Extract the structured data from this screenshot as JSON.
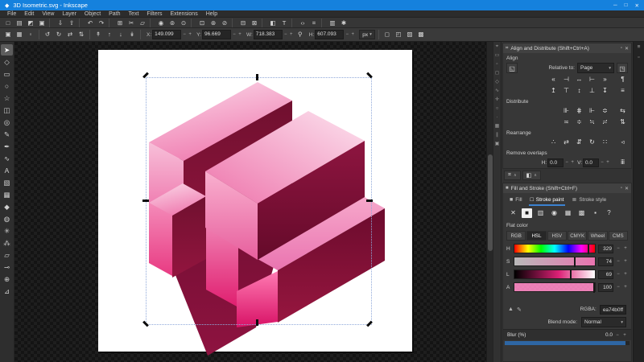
{
  "window": {
    "title": "3D Isometric.svg - Inkscape",
    "logo_glyph": "◆",
    "minimize_glyph": "─",
    "maximize_glyph": "□",
    "close_glyph": "✕"
  },
  "menu": {
    "items": [
      "File",
      "Edit",
      "View",
      "Layer",
      "Object",
      "Path",
      "Text",
      "Filters",
      "Extensions",
      "Help"
    ]
  },
  "command_toolbar": {
    "items": [
      {
        "name": "new-document-icon",
        "glyph": "□"
      },
      {
        "name": "open-icon",
        "glyph": "▤"
      },
      {
        "name": "save-icon",
        "glyph": "◩"
      },
      {
        "name": "print-icon",
        "glyph": "▣"
      },
      {
        "sep": "true",
        "inter": "false"
      },
      {
        "name": "import-icon",
        "glyph": "⇩"
      },
      {
        "name": "export-icon",
        "glyph": "⇧"
      },
      {
        "sep": "true",
        "inter": "false"
      },
      {
        "name": "undo-icon",
        "glyph": "↶"
      },
      {
        "name": "redo-icon",
        "glyph": "↷"
      },
      {
        "sep": "true",
        "inter": "false"
      },
      {
        "name": "copy-icon",
        "glyph": "⊞"
      },
      {
        "name": "cut-icon",
        "glyph": "✂"
      },
      {
        "name": "paste-icon",
        "glyph": "▱"
      },
      {
        "sep": "true",
        "inter": "false"
      },
      {
        "name": "zoom-selection-icon",
        "glyph": "◉"
      },
      {
        "name": "zoom-drawing-icon",
        "glyph": "⊚"
      },
      {
        "name": "zoom-page-icon",
        "glyph": "⊙"
      },
      {
        "sep": "true",
        "inter": "false"
      },
      {
        "name": "duplicate-icon",
        "glyph": "⊡"
      },
      {
        "name": "clone-icon",
        "glyph": "⊛"
      },
      {
        "name": "unlink-clone-icon",
        "glyph": "⊘"
      },
      {
        "sep": "true",
        "inter": "false"
      },
      {
        "name": "group-icon",
        "glyph": "⊟"
      },
      {
        "name": "ungroup-icon",
        "glyph": "⊠"
      },
      {
        "sep": "true",
        "inter": "false"
      },
      {
        "name": "fill-stroke-dialog-icon",
        "glyph": "◧"
      },
      {
        "name": "text-dialog-icon",
        "glyph": "T"
      },
      {
        "sep": "true",
        "inter": "false"
      },
      {
        "name": "xml-editor-icon",
        "glyph": "‹›"
      },
      {
        "name": "align-dialog-icon",
        "glyph": "⌗"
      },
      {
        "sep": "true",
        "inter": "false"
      },
      {
        "name": "document-properties-icon",
        "glyph": "▥"
      },
      {
        "name": "preferences-icon",
        "glyph": "✱"
      }
    ]
  },
  "tool_options": {
    "select_icons": [
      {
        "name": "select-all-icon",
        "glyph": "▣"
      },
      {
        "name": "select-all-layers-icon",
        "glyph": "▦"
      },
      {
        "name": "deselect-icon",
        "glyph": "▫"
      }
    ],
    "transform_icons": [
      {
        "name": "rotate-ccw-icon",
        "glyph": "↺"
      },
      {
        "name": "rotate-cw-icon",
        "glyph": "↻"
      },
      {
        "name": "flip-horizontal-icon",
        "glyph": "⇄"
      },
      {
        "name": "flip-vertical-icon",
        "glyph": "⇅"
      }
    ],
    "zorder_icons": [
      {
        "name": "raise-to-top-icon",
        "glyph": "↟"
      },
      {
        "name": "raise-icon",
        "glyph": "↑"
      },
      {
        "name": "lower-icon",
        "glyph": "↓"
      },
      {
        "name": "lower-to-bottom-icon",
        "glyph": "↡"
      }
    ],
    "x_label": "X:",
    "x_value": "149.099",
    "y_label": "Y:",
    "y_value": "96.669",
    "w_label": "W:",
    "w_value": "718.383",
    "h_label": "H:",
    "h_value": "607.093",
    "lock_glyph": "⚲",
    "units_value": "px",
    "dropdown_caret": "▾",
    "minus": "−",
    "plus": "+",
    "affect_icons": [
      {
        "name": "transform-stroke-icon",
        "glyph": "◻"
      },
      {
        "name": "transform-corners-icon",
        "glyph": "◰"
      },
      {
        "name": "transform-gradient-icon",
        "glyph": "▨"
      },
      {
        "name": "transform-pattern-icon",
        "glyph": "▩"
      }
    ]
  },
  "toolbox": {
    "tools": [
      {
        "name": "selector-tool",
        "glyph": "➤",
        "active": "true"
      },
      {
        "name": "node-tool",
        "glyph": "◇"
      },
      {
        "name": "rectangle-tool",
        "glyph": "▭"
      },
      {
        "name": "ellipse-tool",
        "glyph": "○"
      },
      {
        "name": "star-tool",
        "glyph": "☆"
      },
      {
        "name": "box3d-tool",
        "glyph": "◫"
      },
      {
        "name": "spiral-tool",
        "glyph": "◎"
      },
      {
        "name": "pencil-tool",
        "glyph": "✎"
      },
      {
        "name": "pen-tool",
        "glyph": "✒"
      },
      {
        "name": "calligraphy-tool",
        "glyph": "∿"
      },
      {
        "name": "text-tool",
        "glyph": "A"
      },
      {
        "name": "gradient-tool",
        "glyph": "▧"
      },
      {
        "name": "mesh-tool",
        "glyph": "▦"
      },
      {
        "name": "dropper-tool",
        "glyph": "◆"
      },
      {
        "name": "paint-bucket-tool",
        "glyph": "◍"
      },
      {
        "name": "tweak-tool",
        "glyph": "✳"
      },
      {
        "name": "spray-tool",
        "glyph": "⁂"
      },
      {
        "name": "eraser-tool",
        "glyph": "▱"
      },
      {
        "name": "connector-tool",
        "glyph": "⊸"
      },
      {
        "name": "zoom-tool",
        "glyph": "⊕"
      },
      {
        "name": "measure-tool",
        "glyph": "⊿"
      }
    ]
  },
  "snap_toolbar": {
    "items": [
      {
        "name": "snap-toggle-icon",
        "glyph": "⌖"
      },
      {
        "name": "snap-bbox-icon",
        "glyph": "▭"
      },
      {
        "name": "snap-bbox-edges-icon",
        "glyph": "▫"
      },
      {
        "name": "snap-bbox-corners-icon",
        "glyph": "◻"
      },
      {
        "name": "snap-nodes-icon",
        "glyph": "◇"
      },
      {
        "name": "snap-path-icon",
        "glyph": "∿"
      },
      {
        "name": "snap-intersections-icon",
        "glyph": "✛"
      },
      {
        "name": "snap-centers-icon",
        "glyph": "○"
      },
      {
        "name": "snap-midpoints-icon",
        "glyph": "∙"
      },
      {
        "name": "snap-grid-icon",
        "glyph": "▦"
      },
      {
        "name": "snap-guides-icon",
        "glyph": "∥"
      },
      {
        "name": "snap-page-icon",
        "glyph": "▣"
      }
    ]
  },
  "align_panel": {
    "title": "Align and Distribute (Shift+Ctrl+A)",
    "dock_glyph": "▫",
    "close_glyph": "✕",
    "align_label": "Align",
    "group_toggle_glyph": "◱",
    "relative_label": "Relative to:",
    "relative_value": "Page",
    "caret": "▾",
    "move_as_group_glyph": "◳",
    "align_h_row": [
      {
        "name": "align-right-to-anchor-left",
        "glyph": "«"
      },
      {
        "name": "align-left-edges",
        "glyph": "⊣"
      },
      {
        "name": "center-horizontal",
        "glyph": "↔"
      },
      {
        "name": "align-right-edges",
        "glyph": "⊢"
      },
      {
        "name": "align-left-to-anchor-right",
        "glyph": "»"
      },
      {
        "name": "text-align-horizontal",
        "glyph": "¶"
      }
    ],
    "align_v_row": [
      {
        "name": "align-bottom-to-anchor-top",
        "glyph": "↥"
      },
      {
        "name": "align-top-edges",
        "glyph": "⊤"
      },
      {
        "name": "center-vertical",
        "glyph": "↕"
      },
      {
        "name": "align-bottom-edges",
        "glyph": "⊥"
      },
      {
        "name": "align-top-to-anchor-bottom",
        "glyph": "↧"
      },
      {
        "name": "text-align-vertical",
        "glyph": "≡"
      }
    ],
    "distribute_label": "Distribute",
    "distribute_row1": [
      {
        "name": "distribute-left-edges",
        "glyph": "⊪"
      },
      {
        "name": "distribute-centers-horizontally",
        "glyph": "⋕"
      },
      {
        "name": "distribute-right-edges",
        "glyph": "⊩"
      },
      {
        "name": "distribute-horizontal-gaps",
        "glyph": "≎"
      },
      {
        "name": "exchange-positions",
        "glyph": "⇆"
      }
    ],
    "distribute_row2": [
      {
        "name": "distribute-top-edges",
        "glyph": "≍"
      },
      {
        "name": "distribute-centers-vertically",
        "glyph": "≑"
      },
      {
        "name": "distribute-bottom-edges",
        "glyph": "≒"
      },
      {
        "name": "distribute-vertical-gaps",
        "glyph": "≓"
      },
      {
        "name": "exchange-z-order",
        "glyph": "⇅"
      }
    ],
    "rearrange_label": "Rearrange",
    "rearrange_row": [
      {
        "name": "graph-layout",
        "glyph": "∴"
      },
      {
        "name": "exchange-selection-order",
        "glyph": "⇄"
      },
      {
        "name": "exchange-stacking-order",
        "glyph": "⇵"
      },
      {
        "name": "rotate-positions",
        "glyph": "↻"
      },
      {
        "name": "randomize-positions",
        "glyph": "∷"
      },
      {
        "name": "unclump",
        "glyph": "◃"
      }
    ],
    "remove_overlaps_label": "Remove overlaps",
    "h_label": "H:",
    "h_value": "0.0",
    "v_label": "V:",
    "v_value": "0.0",
    "minus": "−",
    "plus": "+",
    "remove_overlaps_glyph": "ⅲ",
    "footer_tabs": [
      {
        "name": "dialog-tab-align",
        "glyph": "⌗",
        "caret": "∧"
      },
      {
        "name": "dialog-tab-fill-stroke",
        "glyph": "◧",
        "caret": "∧"
      }
    ]
  },
  "fill_stroke_panel": {
    "title": "Fill and Stroke (Shift+Ctrl+F)",
    "dock_glyph": "▫",
    "close_glyph": "✕",
    "tabs": [
      {
        "name": "tab-fill",
        "label": "Fill",
        "glyph": "■"
      },
      {
        "name": "tab-stroke-paint",
        "label": "Stroke paint",
        "glyph": "□",
        "active": "true"
      },
      {
        "name": "tab-stroke-style",
        "label": "Stroke style",
        "glyph": "≣"
      }
    ],
    "paint_buttons": [
      {
        "name": "paint-none",
        "glyph": "✕"
      },
      {
        "name": "paint-flat-color",
        "glyph": "■",
        "active": "true"
      },
      {
        "name": "paint-linear-gradient",
        "glyph": "▥"
      },
      {
        "name": "paint-radial-gradient",
        "glyph": "◉"
      },
      {
        "name": "paint-pattern",
        "glyph": "▦"
      },
      {
        "name": "paint-swatch",
        "glyph": "▩"
      },
      {
        "name": "paint-unknown",
        "glyph": "▪"
      },
      {
        "name": "paint-help",
        "glyph": "?"
      }
    ],
    "flat_color_label": "Flat color",
    "mode_tabs": [
      {
        "name": "mode-rgb",
        "label": "RGB"
      },
      {
        "name": "mode-hsl",
        "label": "HSL",
        "active": "true"
      },
      {
        "name": "mode-hsv",
        "label": "HSV"
      },
      {
        "name": "mode-cmyk",
        "label": "CMYK"
      },
      {
        "name": "mode-wheel",
        "label": "Wheel"
      },
      {
        "name": "mode-cms",
        "label": "CMS"
      }
    ],
    "sliders": [
      {
        "name": "hue-slider",
        "label": "H",
        "value": "329",
        "track": "hue",
        "mstyle": "left:91.4%",
        "minus": "−",
        "plus": "+"
      },
      {
        "name": "saturation-slider",
        "label": "S",
        "value": "74",
        "track": "sat",
        "mstyle": "left:74%",
        "minus": "−",
        "plus": "+"
      },
      {
        "name": "lightness-slider",
        "label": "L",
        "value": "69",
        "track": "lig",
        "mstyle": "left:69%",
        "minus": "−",
        "plus": "+"
      },
      {
        "name": "alpha-slider",
        "label": "A",
        "value": "100",
        "track": "alp",
        "mstyle": "left:98%",
        "minus": "−",
        "plus": "+"
      }
    ],
    "out_of_gamut_glyph": "▲",
    "picker_glyph": "✎",
    "rgba_label": "RGBA:",
    "rgba_value": "ea74b0ff",
    "blend_label": "Blend mode:",
    "blend_value": "Normal",
    "caret": "▾",
    "blur_label": "Blur (%)",
    "blur_value": "0.0",
    "minus": "−",
    "plus": "+"
  },
  "edge_strip": {
    "items": [
      {
        "name": "dock-menu-icon",
        "glyph": "≡"
      },
      {
        "name": "dock-float-icon",
        "glyph": "▫"
      }
    ]
  },
  "colors": {
    "titlebar_blue": "#1581dd",
    "accent_blue": "#3b82d0",
    "artwork_pink": "#ea74b0",
    "selection_dash": "#90a9da"
  }
}
